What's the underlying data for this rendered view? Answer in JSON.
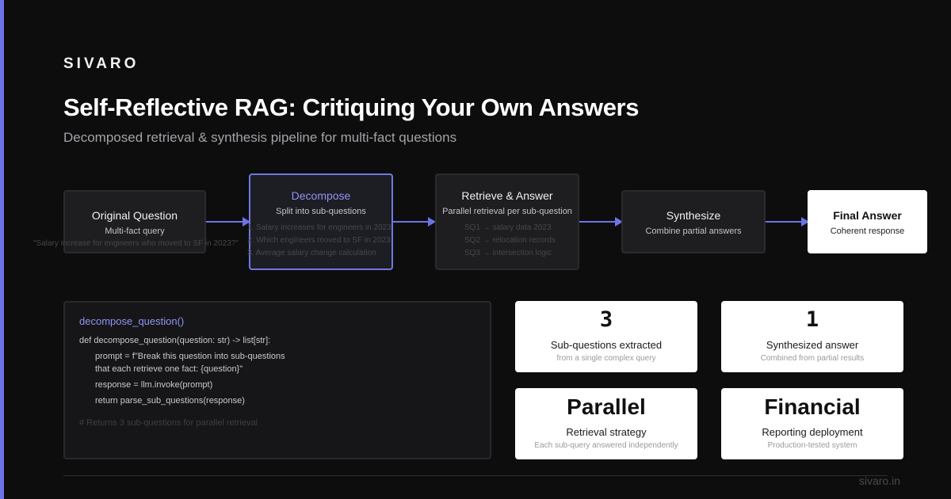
{
  "brand": "SIVARO",
  "title": "Self-Reflective RAG: Critiquing Your Own Answers",
  "subtitle": "Decomposed retrieval & synthesis pipeline for multi-fact questions",
  "pipeline": {
    "original": {
      "title": "Original Question",
      "sub": "Multi-fact query",
      "detail": "\"Salary increase for engineers who moved to SF in 2023?\""
    },
    "decompose": {
      "title": "Decompose",
      "sub": "Split into sub-questions",
      "details": [
        "1. Salary increases for engineers in 2023",
        "2. Which engineers moved to SF in 2023",
        "3. Average salary change calculation"
      ]
    },
    "retrieve": {
      "title": "Retrieve & Answer",
      "sub": "Parallel retrieval per sub-question",
      "details": [
        "SQ1 → salary data 2023",
        "SQ2 → relocation records",
        "SQ3 → intersection logic"
      ]
    },
    "synthesize": {
      "title": "Synthesize",
      "sub": "Combine partial answers"
    },
    "final": {
      "title": "Final Answer",
      "sub": "Coherent response"
    }
  },
  "code": {
    "function_name": "decompose_question()",
    "lines": [
      "def decompose_question(question: str) -> list[str]:",
      "prompt = f\"Break this question into sub-questions",
      "that each retrieve one fact: {question}\"",
      "response = llm.invoke(prompt)",
      "return parse_sub_questions(response)"
    ],
    "comment": "# Returns 3 sub-questions for parallel retrieval"
  },
  "stats": [
    {
      "value": "3",
      "label": "Sub-questions extracted",
      "note": "from a single complex query"
    },
    {
      "value": "1",
      "label": "Synthesized answer",
      "note": "Combined from partial results"
    },
    {
      "value": "Parallel",
      "label": "Retrieval strategy",
      "note": "Each sub-query answered independently"
    },
    {
      "value": "Financial",
      "label": "Reporting deployment",
      "note": "Production-tested system"
    }
  ],
  "footer": {
    "url": "sivaro.in"
  },
  "colors": {
    "accent": "#6b74e6",
    "background": "#0d0d0e"
  }
}
